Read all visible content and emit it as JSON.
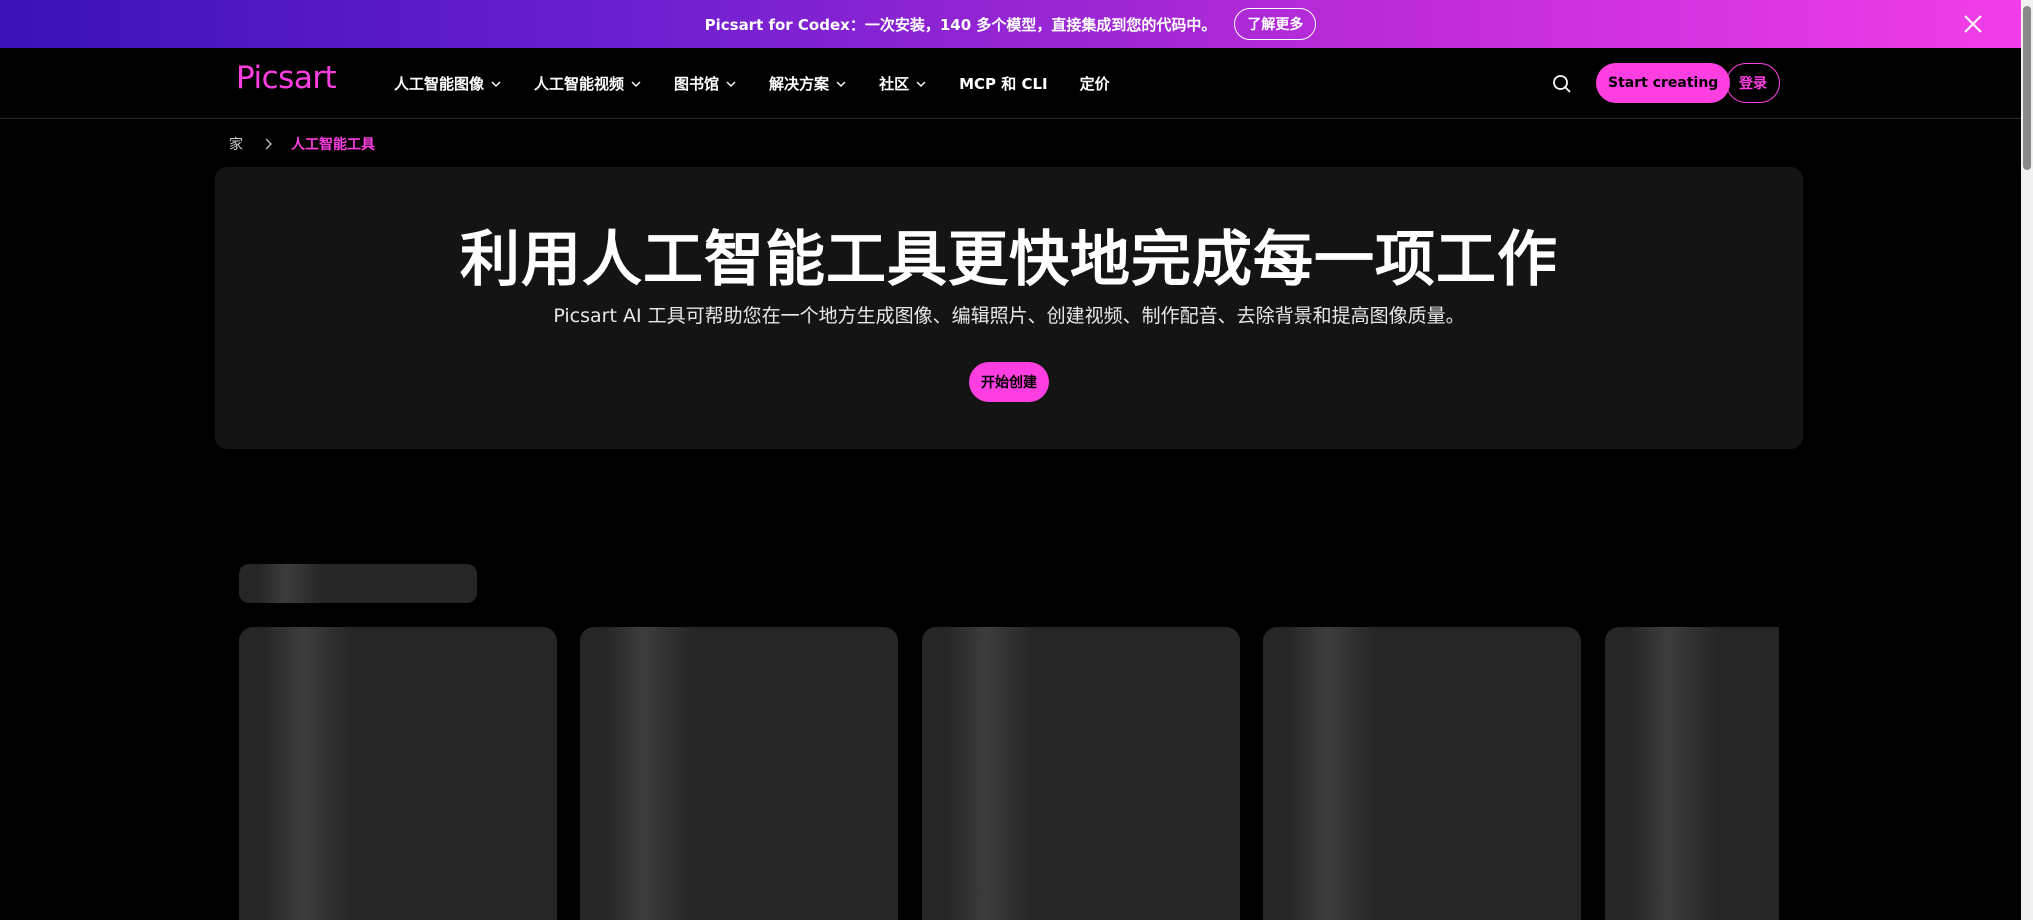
{
  "promo": {
    "text": "Picsart for Codex：一次安装，140 多个模型，直接集成到您的代码中。",
    "button_label": "了解更多"
  },
  "nav": {
    "logo": "Picsart",
    "items": [
      {
        "label": "人工智能图像",
        "dropdown": true
      },
      {
        "label": "人工智能视频",
        "dropdown": true
      },
      {
        "label": "图书馆",
        "dropdown": true
      },
      {
        "label": "解决方案",
        "dropdown": true
      },
      {
        "label": "社区",
        "dropdown": true
      },
      {
        "label": "MCP 和 CLI",
        "dropdown": false
      },
      {
        "label": "定价",
        "dropdown": false
      }
    ],
    "start_label": "Start creating",
    "login_label": "登录"
  },
  "breadcrumb": {
    "home": "家",
    "current": "人工智能工具"
  },
  "hero": {
    "title": "利用人工智能工具更快地完成每一项工作",
    "subtitle": "Picsart AI 工具可帮助您在一个地方生成图像、编辑照片、创建视频、制作配音、去除背景和提高图像质量。",
    "cta_label": "开始创建"
  },
  "colors": {
    "accent": "#ff3ee2",
    "background": "#000000",
    "hero_bg": "#141414"
  }
}
